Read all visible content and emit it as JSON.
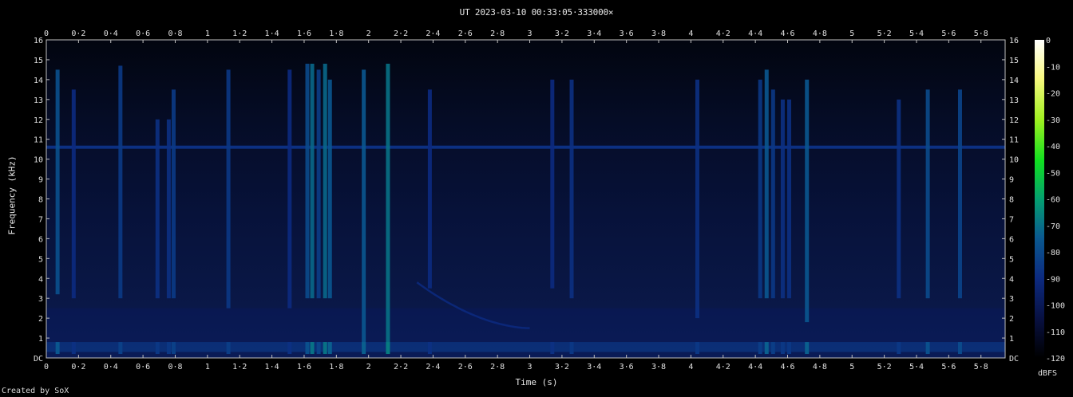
{
  "chart_data": {
    "type": "heatmap",
    "title": "UT 2023-03-10 00:33:05·333000×",
    "xlabel": "Time (s)",
    "ylabel": "Frequency (kHz)",
    "credit": "Created by SoX",
    "xlim": [
      0,
      5.95
    ],
    "ylim": [
      0,
      16
    ],
    "x_ticks": [
      0,
      0.2,
      0.4,
      0.6,
      0.8,
      1,
      1.2,
      1.4,
      1.6,
      1.8,
      2,
      2.2,
      2.4,
      2.6,
      2.8,
      3,
      3.2,
      3.4,
      3.6,
      3.8,
      4,
      4.2,
      4.4,
      4.6,
      4.8,
      5,
      5.2,
      5.4,
      5.6,
      5.8
    ],
    "x_tick_labels": [
      "0",
      "0·2",
      "0·4",
      "0·6",
      "0·8",
      "1",
      "1·2",
      "1·4",
      "1·6",
      "1·8",
      "2",
      "2·2",
      "2·4",
      "2·6",
      "2·8",
      "3",
      "3·2",
      "3·4",
      "3·6",
      "3·8",
      "4",
      "4·2",
      "4·4",
      "4·6",
      "4·8",
      "5",
      "5·2",
      "5·4",
      "5·6",
      "5·8"
    ],
    "y_ticks": [
      0,
      1,
      2,
      3,
      4,
      5,
      6,
      7,
      8,
      9,
      10,
      11,
      12,
      13,
      14,
      15,
      16
    ],
    "y_tick_labels": [
      "DC",
      "1",
      "2",
      "3",
      "4",
      "5",
      "6",
      "7",
      "8",
      "9",
      "10",
      "11",
      "12",
      "13",
      "14",
      "15",
      "16"
    ],
    "colorbar": {
      "label": "dBFS",
      "range": [
        -120,
        0
      ],
      "ticks": [
        0,
        -10,
        -20,
        -30,
        -40,
        -50,
        -60,
        -70,
        -80,
        -90,
        -100,
        -110,
        -120
      ],
      "tick_labels": [
        "0",
        "-10",
        "-20",
        "-30",
        "-40",
        "-50",
        "-60",
        "-70",
        "-80",
        "-90",
        "-100",
        "-110",
        "-120"
      ]
    },
    "background_db": -103,
    "noise_floor_band_khz": [
      0,
      2.5
    ],
    "horizontal_line": {
      "freq_khz": 10.6,
      "db": -88
    },
    "sweep": {
      "t_start": 2.3,
      "t_end": 3.0,
      "f_start": 3.8,
      "f_end": 1.5,
      "db": -90
    },
    "impulses": [
      {
        "t": 0.07,
        "f_low": 3.2,
        "f_high": 14.5,
        "db": -78
      },
      {
        "t": 0.17,
        "f_low": 3.0,
        "f_high": 13.5,
        "db": -90
      },
      {
        "t": 0.46,
        "f_low": 3.0,
        "f_high": 14.7,
        "db": -85
      },
      {
        "t": 0.69,
        "f_low": 3.0,
        "f_high": 12.0,
        "db": -88
      },
      {
        "t": 0.76,
        "f_low": 3.0,
        "f_high": 12.0,
        "db": -88
      },
      {
        "t": 0.79,
        "f_low": 3.0,
        "f_high": 13.5,
        "db": -85
      },
      {
        "t": 1.13,
        "f_low": 2.5,
        "f_high": 14.5,
        "db": -86
      },
      {
        "t": 1.51,
        "f_low": 2.5,
        "f_high": 14.5,
        "db": -90
      },
      {
        "t": 1.62,
        "f_low": 3.0,
        "f_high": 14.8,
        "db": -80
      },
      {
        "t": 1.65,
        "f_low": 3.0,
        "f_high": 14.8,
        "db": -72
      },
      {
        "t": 1.69,
        "f_low": 3.0,
        "f_high": 14.5,
        "db": -84
      },
      {
        "t": 1.73,
        "f_low": 3.0,
        "f_high": 14.8,
        "db": -72
      },
      {
        "t": 1.76,
        "f_low": 3.0,
        "f_high": 14.0,
        "db": -76
      },
      {
        "t": 1.97,
        "f_low": 0.5,
        "f_high": 14.5,
        "db": -76
      },
      {
        "t": 2.12,
        "f_low": 0.5,
        "f_high": 14.8,
        "db": -70
      },
      {
        "t": 2.38,
        "f_low": 3.5,
        "f_high": 13.5,
        "db": -90
      },
      {
        "t": 3.14,
        "f_low": 3.5,
        "f_high": 14.0,
        "db": -90
      },
      {
        "t": 3.26,
        "f_low": 3.0,
        "f_high": 14.0,
        "db": -88
      },
      {
        "t": 4.04,
        "f_low": 2.0,
        "f_high": 14.0,
        "db": -88
      },
      {
        "t": 4.43,
        "f_low": 3.0,
        "f_high": 14.0,
        "db": -86
      },
      {
        "t": 4.47,
        "f_low": 3.0,
        "f_high": 14.5,
        "db": -76
      },
      {
        "t": 4.51,
        "f_low": 3.0,
        "f_high": 13.5,
        "db": -86
      },
      {
        "t": 4.57,
        "f_low": 3.0,
        "f_high": 13.0,
        "db": -88
      },
      {
        "t": 4.61,
        "f_low": 3.0,
        "f_high": 13.0,
        "db": -88
      },
      {
        "t": 4.72,
        "f_low": 1.8,
        "f_high": 14.0,
        "db": -76
      },
      {
        "t": 5.29,
        "f_low": 3.0,
        "f_high": 13.0,
        "db": -88
      },
      {
        "t": 5.47,
        "f_low": 3.0,
        "f_high": 13.5,
        "db": -80
      },
      {
        "t": 5.67,
        "f_low": 3.0,
        "f_high": 13.5,
        "db": -82
      }
    ]
  }
}
